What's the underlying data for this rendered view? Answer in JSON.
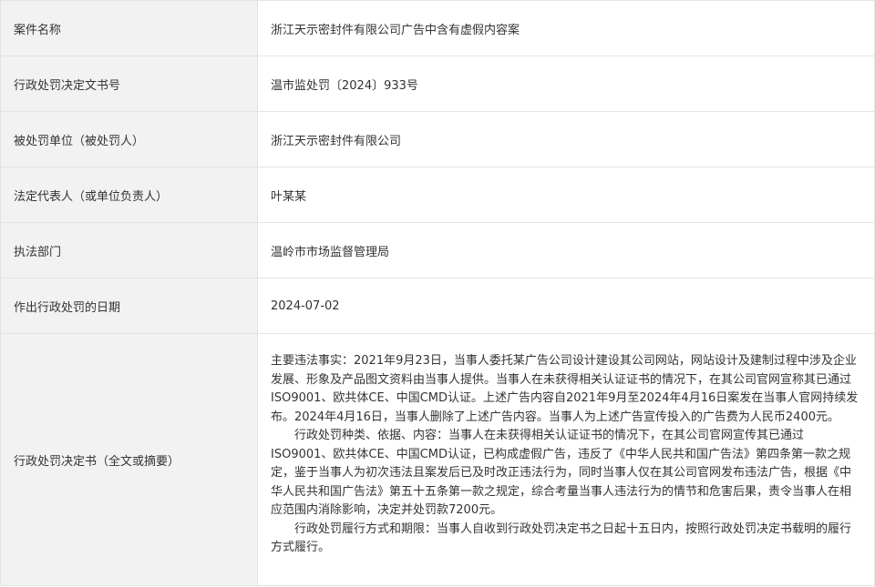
{
  "rows": [
    {
      "label": "案件名称",
      "value": "浙江天示密封件有限公司广告中含有虚假内容案"
    },
    {
      "label": "行政处罚决定文书号",
      "value": "温市监处罚〔2024〕933号"
    },
    {
      "label": "被处罚单位（被处罚人）",
      "value": "浙江天示密封件有限公司"
    },
    {
      "label": "法定代表人（或单位负责人）",
      "value": "叶某某"
    },
    {
      "label": "执法部门",
      "value": "温岭市市场监督管理局"
    },
    {
      "label": "作出行政处罚的日期",
      "value": "2024-07-02"
    }
  ],
  "decision": {
    "label": "行政处罚决定书（全文或摘要）",
    "paragraphs": [
      "主要违法事实：2021年9月23日，当事人委托某广告公司设计建设其公司网站，网站设计及建制过程中涉及企业发展、形象及产品图文资料由当事人提供。当事人在未获得相关认证证书的情况下，在其公司官网宣称其已通过ISO9001、欧共体CE、中国CMD认证。上述广告内容自2021年9月至2024年4月16日案发在当事人官网持续发布。2024年4月16日，当事人删除了上述广告内容。当事人为上述广告宣传投入的广告费为人民币2400元。",
      "行政处罚种类、依据、内容：当事人在未获得相关认证证书的情况下，在其公司官网宣传其已通过ISO9001、欧共体CE、中国CMD认证，已构成虚假广告，违反了《中华人民共和国广告法》第四条第一款之规定，鉴于当事人为初次违法且案发后已及时改正违法行为，同时当事人仅在其公司官网发布违法广告，根据《中华人民共和国广告法》第五十五条第一款之规定，综合考量当事人违法行为的情节和危害后果，责令当事人在相应范围内消除影响，决定并处罚款7200元。",
      "行政处罚履行方式和期限：当事人自收到行政处罚决定书之日起十五日内，按照行政处罚决定书载明的履行方式履行。"
    ]
  }
}
